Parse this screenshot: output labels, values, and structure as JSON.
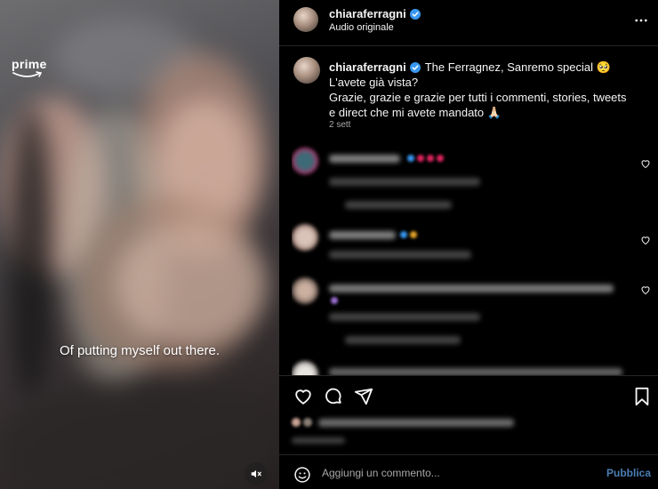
{
  "media": {
    "brand": "prime",
    "subtitle": "Of putting myself out there.",
    "mute_icon": "mute-icon"
  },
  "header": {
    "username": "chiaraferragni",
    "audio": "Audio originale",
    "verified_color": "#3897f0"
  },
  "caption": {
    "username": "chiaraferragni",
    "text_line1": "The Ferragnez, Sanremo special 🥺",
    "text_line2": "L'avete già vista?",
    "text_line3": "Grazie, grazie e grazie per tutti i commenti, stories, tweets e direct che mi avete mandato 🙏🏻",
    "time": "2 sett"
  },
  "actions": {
    "like_icon": "heart-icon",
    "comment_icon": "comment-icon",
    "share_icon": "share-icon",
    "save_icon": "bookmark-icon"
  },
  "add_comment": {
    "placeholder": "Aggiungi un commento...",
    "publish_label": "Pubblica"
  },
  "colors": {
    "background": "#000000",
    "divider": "#262626",
    "link_blue": "#4a7eb4",
    "secondary_text": "#a8a8a8"
  }
}
